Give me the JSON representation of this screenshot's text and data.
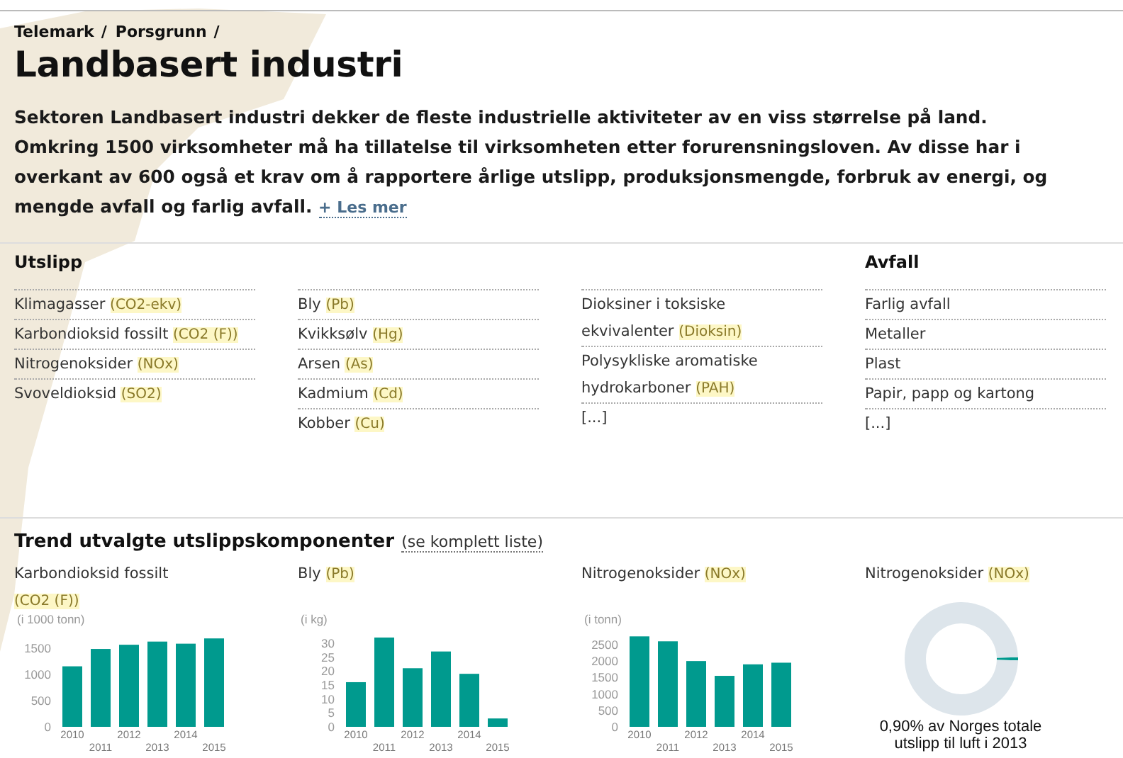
{
  "breadcrumb": [
    {
      "label": "Telemark",
      "separator": "/"
    },
    {
      "label": "Porsgrunn",
      "separator": "/"
    }
  ],
  "title": "Landbasert industri",
  "intro": {
    "lines": [
      "Sektoren Landbasert industri dekker de fleste industrielle aktiviteter av en viss størrelse på land.",
      "Omkring 1500 virksomheter må ha tillatelse til virksomheten etter forurensningsloven. Av disse har i",
      "overkant av 600 også et krav om å rapportere årlige utslipp, produksjonsmengde, forbruk av energi, og",
      "mengde avfall og farlig avfall."
    ],
    "more_link": "+ Les mer"
  },
  "emissions": {
    "title": "Utslipp",
    "columns": [
      {
        "items": [
          {
            "name": "Klimagasser",
            "code": "(CO2-ekv)"
          },
          {
            "name": "Karbondioksid fossilt",
            "code": "(CO2 (F))"
          },
          {
            "name": "Nitrogenoksider",
            "code": "(NOx)"
          },
          {
            "name": "Svoveldioksid",
            "code": "(SO2)"
          }
        ]
      },
      {
        "items": [
          {
            "name": "Bly",
            "code": "(Pb)"
          },
          {
            "name": "Kvikksølv",
            "code": "(Hg)"
          },
          {
            "name": "Arsen",
            "code": "(As)"
          },
          {
            "name": "Kadmium",
            "code": "(Cd)"
          },
          {
            "name": "Kobber",
            "code": "(Cu)"
          }
        ]
      },
      {
        "items": [
          {
            "name": "Dioksiner i toksiske ekvivalenter",
            "code": "(Dioksin)"
          },
          {
            "name": "Polysykliske aromatiske hydrokarboner",
            "code": "(PAH)"
          }
        ],
        "more": "[...]"
      }
    ]
  },
  "waste": {
    "title": "Avfall",
    "items": [
      {
        "name": "Farlig avfall"
      },
      {
        "name": "Metaller"
      },
      {
        "name": "Plast"
      },
      {
        "name": "Papir, papp og kartong"
      }
    ],
    "more": "[...]"
  },
  "trend": {
    "title": "Trend utvalgte utslippskomponenter",
    "link": "(se komplett liste)",
    "charts": [
      {
        "title": "Karbondioksid fossilt",
        "code": "(CO2 (F))",
        "chart_data": {
          "type": "bar",
          "ylabel": "(i 1000 tonn)",
          "categories": [
            "2010",
            "2011",
            "2012",
            "2013",
            "2014",
            "2015"
          ],
          "series": [
            {
              "color": "#009a8e",
              "values": [
                1150,
                1480,
                1560,
                1620,
                1580,
                1680
              ]
            }
          ],
          "ylim": [
            0,
            1750
          ],
          "yticks": [
            0,
            500,
            1000,
            1500
          ]
        }
      },
      {
        "title": "Bly",
        "code": "(Pb)",
        "chart_data": {
          "type": "bar",
          "ylabel": "(i kg)",
          "categories": [
            "2010",
            "2011",
            "2012",
            "2013",
            "2014",
            "2015"
          ],
          "series": [
            {
              "color": "#009a8e",
              "values": [
                16,
                32,
                21,
                27,
                19,
                3
              ]
            }
          ],
          "ylim": [
            0,
            33
          ],
          "yticks": [
            0,
            5,
            10,
            15,
            20,
            25,
            30
          ]
        }
      },
      {
        "title": "Nitrogenoksider",
        "code": "(NOx)",
        "chart_data": {
          "type": "bar",
          "ylabel": "(i tonn)",
          "categories": [
            "2010",
            "2011",
            "2012",
            "2013",
            "2014",
            "2015"
          ],
          "series": [
            {
              "color": "#009a8e",
              "values": [
                2750,
                2600,
                2000,
                1550,
                1900,
                1950
              ]
            }
          ],
          "ylim": [
            0,
            2800
          ],
          "yticks": [
            0,
            500,
            1000,
            1500,
            2000,
            2500
          ]
        }
      },
      {
        "title": "Nitrogenoksider",
        "code": "(NOx)",
        "chart_data": {
          "type": "donut",
          "series": [
            {
              "values": [
                0.9,
                99.1
              ]
            }
          ]
        },
        "caption": "0,90% av Norges totale utslipp til luft i 2013"
      }
    ]
  }
}
